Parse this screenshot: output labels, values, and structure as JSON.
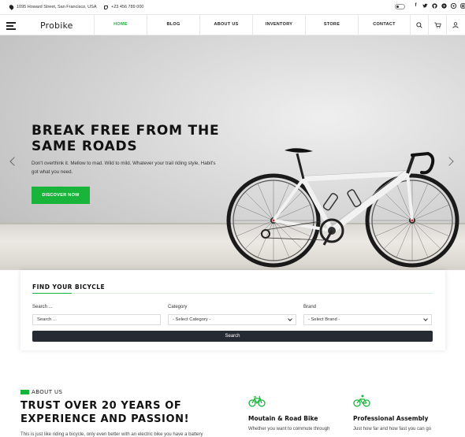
{
  "topbar": {
    "address": "1095 Howard Street, San Francisco, USA",
    "phone": "+23 456 789 000",
    "socials": [
      "f",
      "t",
      "o",
      "yt",
      "p",
      "ig"
    ]
  },
  "nav": {
    "logo": "Probike",
    "items": [
      {
        "label": "HOME",
        "active": true
      },
      {
        "label": "BLOG",
        "active": false
      },
      {
        "label": "ABOUT US",
        "active": false
      },
      {
        "label": "INVENTORY",
        "active": false
      },
      {
        "label": "STORE",
        "active": false
      },
      {
        "label": "CONTACT",
        "active": false
      }
    ],
    "icons": [
      "search-icon",
      "cart-icon",
      "user-icon"
    ]
  },
  "hero": {
    "title_line1": "BREAK FREE FROM THE",
    "title_line2": "SAME ROADS",
    "text": "Don't overthink it. Mellow to mad. Wild to mild. Whatever your trail riding style, Habit's got what you need.",
    "button": "DISCOVER NOW"
  },
  "finder": {
    "title": "FIND YOUR BICYCLE",
    "search_label": "Search ...",
    "search_placeholder": "Search ...",
    "category_label": "Category",
    "category_value": "- Select Category -",
    "brand_label": "Brand",
    "brand_value": "- Select Brand -",
    "button": "Search"
  },
  "about": {
    "tag": "ABOUT US",
    "title_line1": "TRUST OVER 20 YEARS OF",
    "title_line2": "EXPERIENCE AND PASSION!",
    "text": "This is just like riding a bicycle, only even better with an electric bike you have a battery",
    "features": [
      {
        "title": "Moutain & Road Bike",
        "text": "Whether you want to commute through"
      },
      {
        "title": "Professional Assembly",
        "text": "Just how far and how fast you can go"
      }
    ]
  },
  "colors": {
    "accent": "#19b43a",
    "dark_button": "#262a33"
  }
}
